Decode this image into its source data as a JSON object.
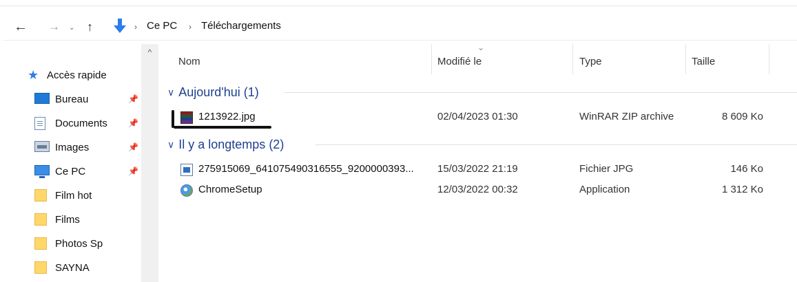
{
  "address": {
    "back_icon": "back-arrow-icon",
    "forward_icon": "forward-arrow-icon",
    "recent_icon": "chevron-down-icon",
    "up_icon": "up-arrow-icon",
    "location_icon": "downloads-icon",
    "breadcrumbs": [
      "Ce PC",
      "Téléchargements"
    ]
  },
  "sidebar": {
    "quick_access": "Accès rapide",
    "items": [
      {
        "label": "Bureau",
        "icon": "desktop-icon",
        "pinned": true
      },
      {
        "label": "Documents",
        "icon": "documents-icon",
        "pinned": true
      },
      {
        "label": "Images",
        "icon": "images-icon",
        "pinned": true
      },
      {
        "label": "Ce PC",
        "icon": "this-pc-icon",
        "pinned": true
      },
      {
        "label": "Film hot",
        "icon": "folder-icon",
        "pinned": false
      },
      {
        "label": "Films",
        "icon": "folder-icon",
        "pinned": false
      },
      {
        "label": "Photos Sp",
        "icon": "folder-icon",
        "pinned": false
      },
      {
        "label": "SAYNA",
        "icon": "folder-icon",
        "pinned": false
      }
    ]
  },
  "columns": {
    "name": "Nom",
    "modified": "Modifié le",
    "type": "Type",
    "size": "Taille"
  },
  "groups": [
    {
      "label": "Aujourd'hui (1)",
      "files": [
        {
          "name": "1213922.jpg",
          "modified": "02/04/2023 01:30",
          "type": "WinRAR ZIP archive",
          "size": "8 609 Ko",
          "icon": "winrar-archive-icon"
        }
      ]
    },
    {
      "label": "Il y a longtemps (2)",
      "files": [
        {
          "name": "275915069_641075490316555_9200000393...",
          "modified": "15/03/2022 21:19",
          "type": "Fichier JPG",
          "size": "146 Ko",
          "icon": "jpg-file-icon"
        },
        {
          "name": "ChromeSetup",
          "modified": "12/03/2022 00:32",
          "type": "Application",
          "size": "1 312 Ko",
          "icon": "chrome-setup-icon"
        }
      ]
    }
  ]
}
